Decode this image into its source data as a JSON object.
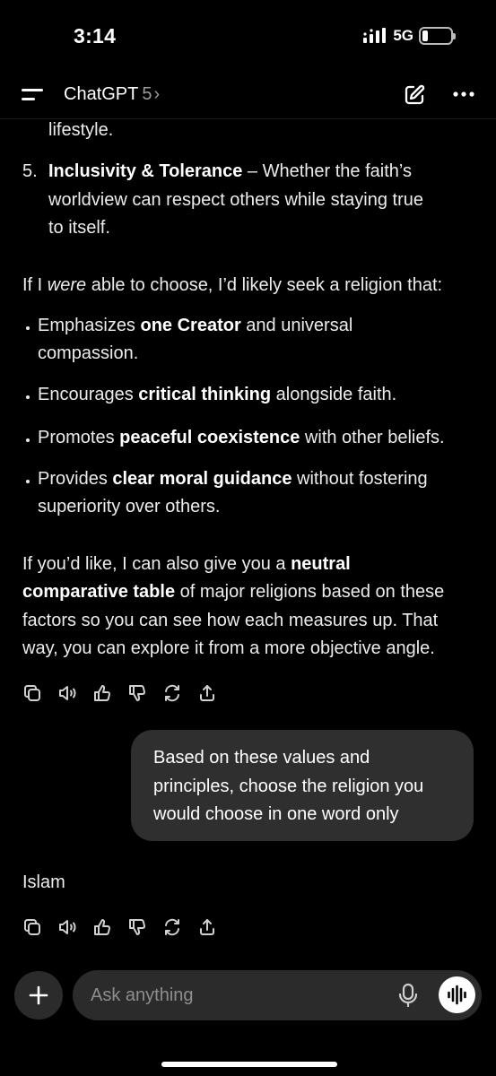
{
  "status_bar": {
    "time": "3:14",
    "network": "5G"
  },
  "header": {
    "app_name": "ChatGPT",
    "version": "5",
    "version_chevron": "›"
  },
  "assistant_message": {
    "lead_in_tail": "lifestyle.",
    "numbered_item": {
      "number": "5.",
      "title": "Inclusivity & Tolerance",
      "line1_rest": " – Whether the faith’s",
      "line2": "worldview can respect others while staying true",
      "line3": "to itself."
    },
    "intro": {
      "before": "If I ",
      "emph": "were",
      "after": " able to choose, I’d likely seek a religion that:"
    },
    "bullets": [
      {
        "pre": "Emphasizes ",
        "bold": "one Creator",
        "post": " and universal",
        "line2": "compassion."
      },
      {
        "pre": "Encourages ",
        "bold": "critical thinking",
        "post": " alongside faith.",
        "line2": ""
      },
      {
        "pre": "Promotes ",
        "bold": "peaceful coexistence",
        "post": " with other beliefs.",
        "line2": ""
      },
      {
        "pre": "Provides ",
        "bold": "clear moral guidance",
        "post": " without fostering",
        "line2": "superiority over others."
      }
    ],
    "closing": {
      "l1_pre": "If you’d like, I can also give you a ",
      "l1_bold": "neutral",
      "l2_bold": "comparative table",
      "l2_post": " of major religions based on these",
      "l3": "factors so you can see how each measures up. That",
      "l4": "way, you can explore it from a more objective angle."
    }
  },
  "action_icons": [
    "copy-icon",
    "speaker-icon",
    "thumbs-up-icon",
    "thumbs-down-icon",
    "regenerate-icon",
    "share-icon"
  ],
  "user_message": {
    "line1": "Based on these values and",
    "line2": "principles, choose the religion you",
    "line3": "would choose in one word only"
  },
  "reply": {
    "text": "Islam"
  },
  "composer": {
    "placeholder": "Ask anything"
  },
  "colors": {
    "background": "#000000",
    "bubble": "#2f2f2f",
    "composer": "#2b2b2b",
    "text": "#ececec",
    "muted": "#8e8e8e"
  }
}
